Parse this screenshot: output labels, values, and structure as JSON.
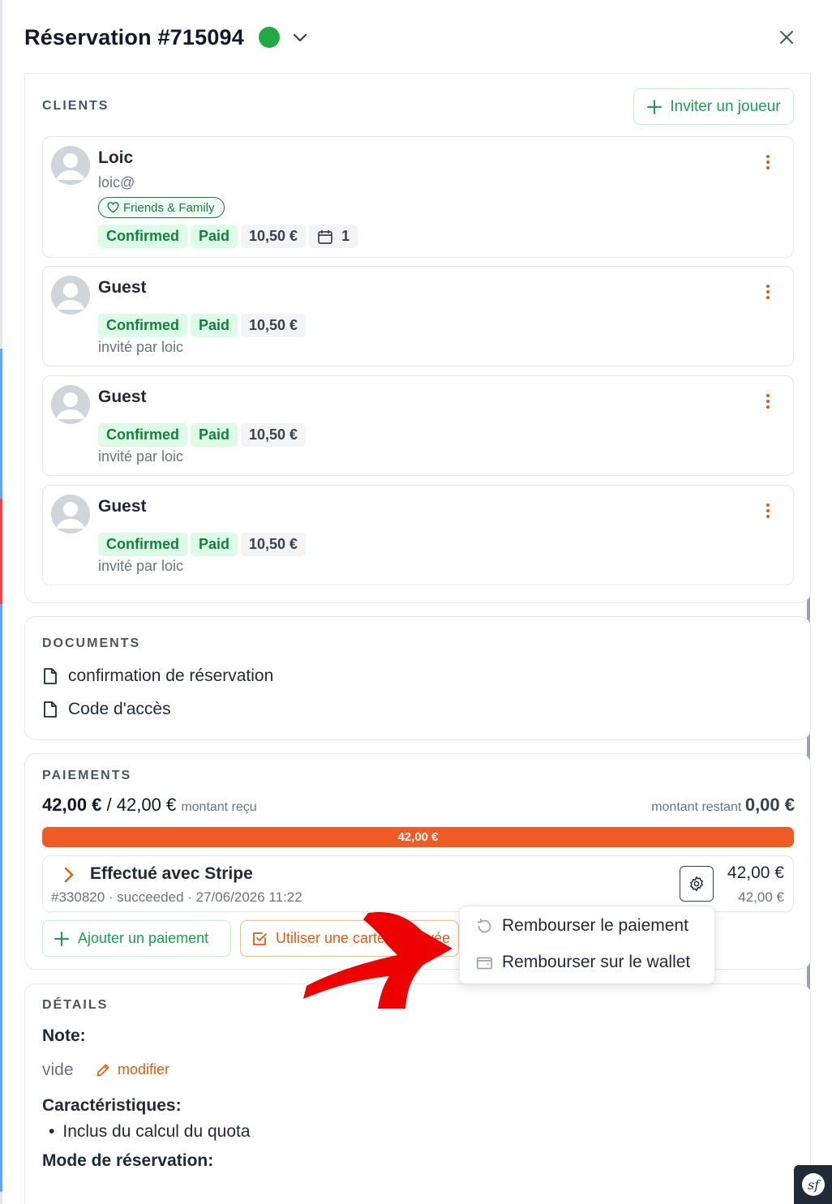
{
  "header": {
    "title": "Réservation #715094",
    "status_color": "#22a845"
  },
  "clients": {
    "label": "CLIENTS",
    "invite_label": "Inviter un joueur",
    "items": [
      {
        "name": "Loic",
        "email": "loic@",
        "tag": "Friends & Family",
        "status": "Confirmed",
        "payment": "Paid",
        "price": "10,50 €",
        "bookings": "1"
      },
      {
        "name": "Guest",
        "status": "Confirmed",
        "payment": "Paid",
        "price": "10,50 €",
        "invited_by": "invité par loic"
      },
      {
        "name": "Guest",
        "status": "Confirmed",
        "payment": "Paid",
        "price": "10,50 €",
        "invited_by": "invité par loic"
      },
      {
        "name": "Guest",
        "status": "Confirmed",
        "payment": "Paid",
        "price": "10,50 €",
        "invited_by": "invité par loic"
      }
    ]
  },
  "documents": {
    "label": "DOCUMENTS",
    "items": [
      "confirmation de réservation",
      "Code d'accès"
    ]
  },
  "payments": {
    "label": "PAIEMENTS",
    "received": "42,00 €",
    "separator": "/",
    "total": "42,00 €",
    "received_label": "montant reçu",
    "remaining_label": "montant restant",
    "remaining": "0,00 €",
    "progress_label": "42,00 €",
    "progress_fraction": 1.0,
    "progress_color": "#f05a24",
    "transaction": {
      "title": "Effectué avec Stripe",
      "meta": "#330820 · succeeded · 27/06/2026 11:22",
      "amount": "42,00 €",
      "amount_sub": "42,00 €"
    },
    "add_payment_label": "Ajouter un paiement",
    "use_card_label": "Utiliser une carte prépayée"
  },
  "refund_menu": {
    "items": [
      "Rembourser le paiement",
      "Rembourser sur le wallet"
    ]
  },
  "details": {
    "label": "DÉTAILS",
    "note_label": "Note:",
    "note_value": "vide",
    "edit_label": "modifier",
    "features_label": "Caractéristiques:",
    "features": [
      "Inclus du calcul du quota"
    ],
    "mode_label": "Mode de réservation:"
  }
}
